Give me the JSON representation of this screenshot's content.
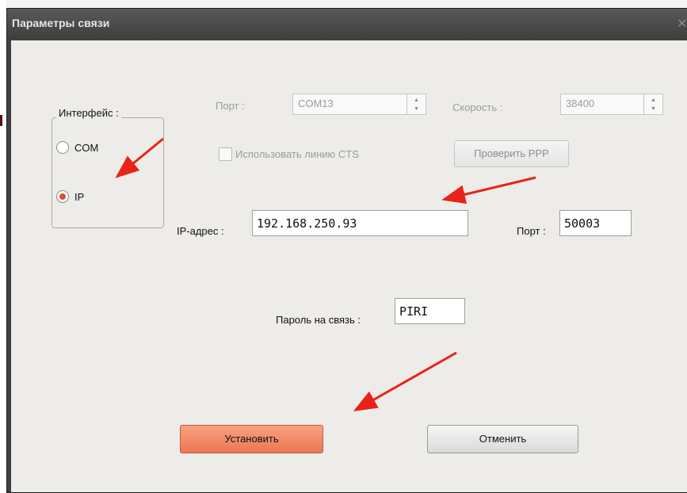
{
  "dialog": {
    "title": "Параметры связи",
    "close_glyph": "✕"
  },
  "interface_group": {
    "label": "Интерфейс :",
    "options": [
      {
        "label": "COM",
        "selected": false
      },
      {
        "label": "IP",
        "selected": true
      }
    ]
  },
  "com_settings": {
    "port_label": "Порт :",
    "port_value": "COM13",
    "speed_label": "Скорость :",
    "speed_value": "38400",
    "cts_label": "Использовать линию CTS",
    "cts_checked": false,
    "check_ppp_label": "Проверить PPP"
  },
  "ip_settings": {
    "ip_label": "IP-адрес :",
    "ip_value": "192.168.250.93",
    "port_label": "Порт :",
    "port_value": "50003",
    "password_label": "Пароль на связь :",
    "password_value": "PIRI"
  },
  "buttons": {
    "apply_label": "Установить",
    "cancel_label": "Отменить"
  },
  "icons": {
    "spin": "spin-updown-icon",
    "close": "close-icon",
    "annotation": "red-arrow-icon"
  },
  "colors": {
    "accent": "#ec7753",
    "radio_selected": "#d5532e",
    "annotation_arrow": "#e8231a",
    "titlebar": "#404040"
  }
}
